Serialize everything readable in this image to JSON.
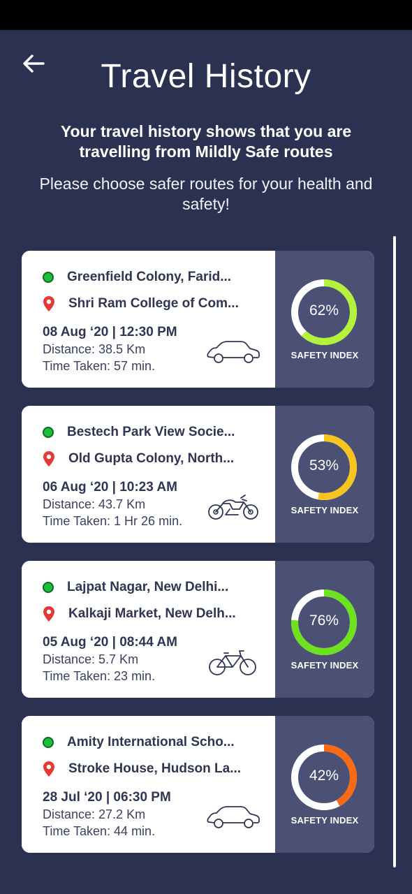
{
  "header": {
    "title": "Travel History",
    "subtitle": "Your travel history shows that you are travelling from Mildly Safe routes",
    "hint": "Please choose safer routes for your health and safety!"
  },
  "trips": [
    {
      "from": "Greenfield Colony, Farid...",
      "to": "Shri Ram College of Com...",
      "datetime": "08 Aug ‘20 | 12:30 PM",
      "distance": "Distance: 38.5 Km",
      "time_taken": "Time Taken: 57 min.",
      "vehicle": "car-icon",
      "safety_value": 62,
      "safety_text": "62%",
      "safety_label": "SAFETY INDEX",
      "ring_color": "#b5f23a"
    },
    {
      "from": "Bestech Park View Socie...",
      "to": "Old Gupta Colony, North...",
      "datetime": "06 Aug ‘20 | 10:23 AM",
      "distance": "Distance: 43.7 Km",
      "time_taken": "Time Taken: 1 Hr 26 min.",
      "vehicle": "motorcycle-icon",
      "safety_value": 53,
      "safety_text": "53%",
      "safety_label": "SAFETY INDEX",
      "ring_color": "#f7c51e"
    },
    {
      "from": "Lajpat Nagar, New Delhi...",
      "to": "Kalkaji Market, New Delh...",
      "datetime": "05 Aug ‘20 | 08:44 AM",
      "distance": "Distance: 5.7 Km",
      "time_taken": "Time Taken: 23 min.",
      "vehicle": "bicycle-icon",
      "safety_value": 76,
      "safety_text": "76%",
      "safety_label": "SAFETY INDEX",
      "ring_color": "#6ee21d"
    },
    {
      "from": "Amity International Scho...",
      "to": "Stroke House, Hudson La...",
      "datetime": "28 Jul ‘20 | 06:30 PM",
      "distance": "Distance: 27.2 Km",
      "time_taken": "Time Taken: 44 min.",
      "vehicle": "car-icon",
      "safety_value": 42,
      "safety_text": "42%",
      "safety_label": "SAFETY INDEX",
      "ring_color": "#fb6a12"
    }
  ],
  "colors": {
    "background": "#2b3150",
    "card_right_panel": "#4a5175",
    "origin_dot": "#1dbf3a",
    "destination_pin": "#e53935"
  }
}
